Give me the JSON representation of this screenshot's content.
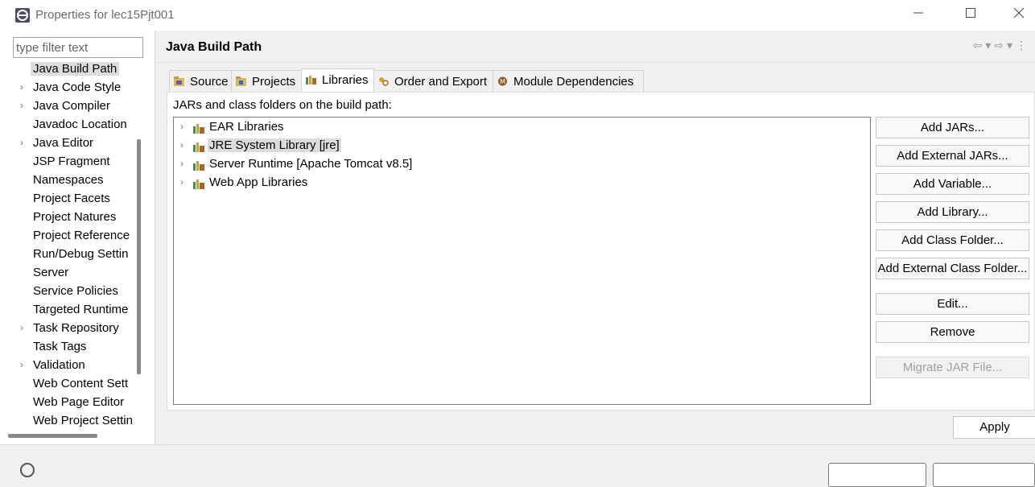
{
  "window": {
    "title": "Properties for lec15Pjt001"
  },
  "filter": {
    "placeholder": "type filter text"
  },
  "sidebar": {
    "items": [
      {
        "label": "Java Build Path",
        "expandable": false,
        "selected": true
      },
      {
        "label": "Java Code Style",
        "expandable": true
      },
      {
        "label": "Java Compiler",
        "expandable": true
      },
      {
        "label": "Javadoc Location",
        "expandable": false
      },
      {
        "label": "Java Editor",
        "expandable": true
      },
      {
        "label": "JSP Fragment",
        "expandable": false
      },
      {
        "label": "Namespaces",
        "expandable": false
      },
      {
        "label": "Project Facets",
        "expandable": false
      },
      {
        "label": "Project Natures",
        "expandable": false
      },
      {
        "label": "Project Reference",
        "expandable": false
      },
      {
        "label": "Run/Debug Settin",
        "expandable": false
      },
      {
        "label": "Server",
        "expandable": false
      },
      {
        "label": "Service Policies",
        "expandable": false
      },
      {
        "label": "Targeted Runtime",
        "expandable": false
      },
      {
        "label": "Task Repository",
        "expandable": true
      },
      {
        "label": "Task Tags",
        "expandable": false
      },
      {
        "label": "Validation",
        "expandable": true
      },
      {
        "label": "Web Content Sett",
        "expandable": false
      },
      {
        "label": "Web Page Editor",
        "expandable": false
      },
      {
        "label": "Web Project Settin",
        "expandable": false
      }
    ]
  },
  "main": {
    "title": "Java Build Path",
    "tabs": [
      {
        "label": "Source",
        "icon": "source-folder-icon"
      },
      {
        "label": "Projects",
        "icon": "projects-icon"
      },
      {
        "label": "Libraries",
        "icon": "libraries-icon",
        "active": true
      },
      {
        "label": "Order and Export",
        "icon": "order-export-icon"
      },
      {
        "label": "Module Dependencies",
        "icon": "module-icon"
      }
    ],
    "panel_label": "JARs and class folders on the build path:",
    "libraries": [
      {
        "label": "EAR Libraries"
      },
      {
        "label": "JRE System Library [jre]",
        "selected": true
      },
      {
        "label": "Server Runtime [Apache Tomcat v8.5]"
      },
      {
        "label": "Web App Libraries"
      }
    ],
    "buttons": {
      "add_jars": "Add JARs...",
      "add_external_jars": "Add External JARs...",
      "add_variable": "Add Variable...",
      "add_library": "Add Library...",
      "add_class_folder": "Add Class Folder...",
      "add_external_class_folder": "Add External Class Folder...",
      "edit": "Edit...",
      "remove": "Remove",
      "migrate_jar": "Migrate JAR File..."
    },
    "apply_label": "Apply"
  },
  "colors": {
    "accent_book": "#c8a040",
    "accent_book_green": "#4a8a4a"
  }
}
